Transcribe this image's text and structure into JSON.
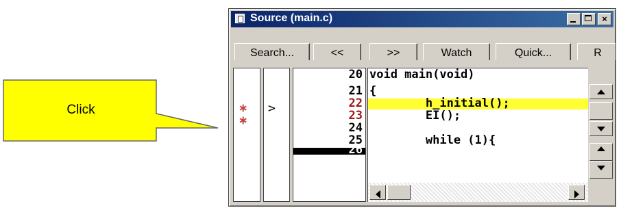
{
  "callout": {
    "text": "Click"
  },
  "window": {
    "title": "Source (main.c)",
    "minimize_label": "",
    "maximize_label": "",
    "close_label": "×"
  },
  "toolbar": {
    "search_label": "Search...",
    "back_label": "<<",
    "forward_label": ">>",
    "watch_label": "Watch",
    "quick_label": "Quick...",
    "r_label": "R"
  },
  "editor": {
    "line_numbers": [
      "20",
      "21",
      "22",
      "23",
      "24",
      "25",
      "26"
    ],
    "breakpoint_mark": "∗",
    "current_arrow": ">",
    "code_lines": [
      "void main(void)",
      "{",
      "        h_initial();",
      "        EI();",
      "",
      "        while (1){"
    ]
  },
  "colors": {
    "callout_fill": "#ffff00",
    "highlight": "#ffff33",
    "breakpoint_line_number": "#a01818",
    "title_bar": "#0a246a"
  }
}
